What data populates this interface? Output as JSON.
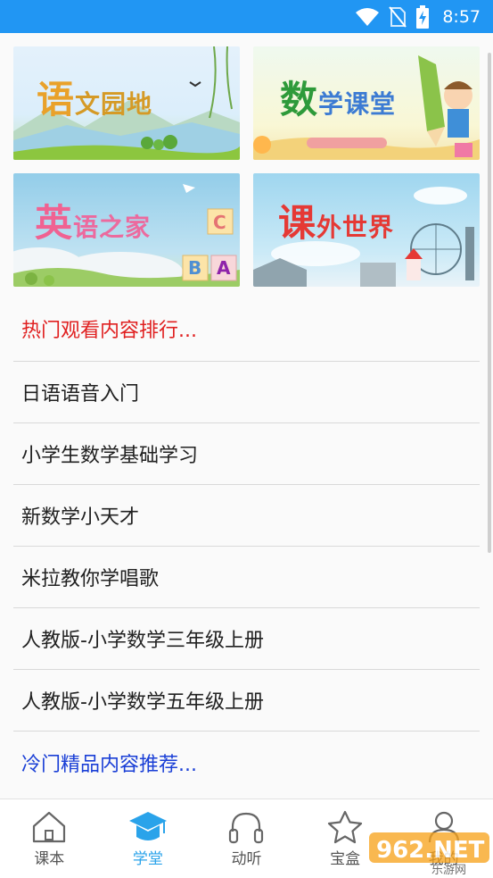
{
  "status_bar": {
    "time": "8:57",
    "icons": [
      "wifi-icon",
      "no-sim-icon",
      "battery-charging-icon"
    ]
  },
  "banners": [
    {
      "id": "chinese",
      "title_big": "语",
      "title_rest": "文园地"
    },
    {
      "id": "math",
      "title_big": "数",
      "title_rest": "学课堂"
    },
    {
      "id": "english",
      "title_big": "英",
      "title_rest": "语之家"
    },
    {
      "id": "world",
      "title_big": "课",
      "title_rest": "外世界"
    }
  ],
  "list": {
    "hot_header": "热门观看内容排行...",
    "items": [
      "日语语音入门",
      "小学生数学基础学习",
      "新数学小天才",
      "米拉教你学唱歌",
      "人教版-小学数学三年级上册",
      "人教版-小学数学五年级上册"
    ],
    "cold_header": "冷门精品内容推荐..."
  },
  "bottom_nav": [
    {
      "label": "课本",
      "icon": "house-icon",
      "active": false
    },
    {
      "label": "学堂",
      "icon": "graduation-cap-icon",
      "active": true
    },
    {
      "label": "动听",
      "icon": "headphones-icon",
      "active": false
    },
    {
      "label": "宝盒",
      "icon": "star-icon",
      "active": false
    },
    {
      "label": "我的",
      "icon": "person-icon",
      "active": false
    }
  ],
  "watermark": {
    "text": "962.NET",
    "subtext": "乐游网"
  },
  "colors": {
    "status_bar": "#2196f3",
    "hot_header": "#e02020",
    "cold_header": "#1a3fd6",
    "nav_active": "#2aa3ea"
  }
}
